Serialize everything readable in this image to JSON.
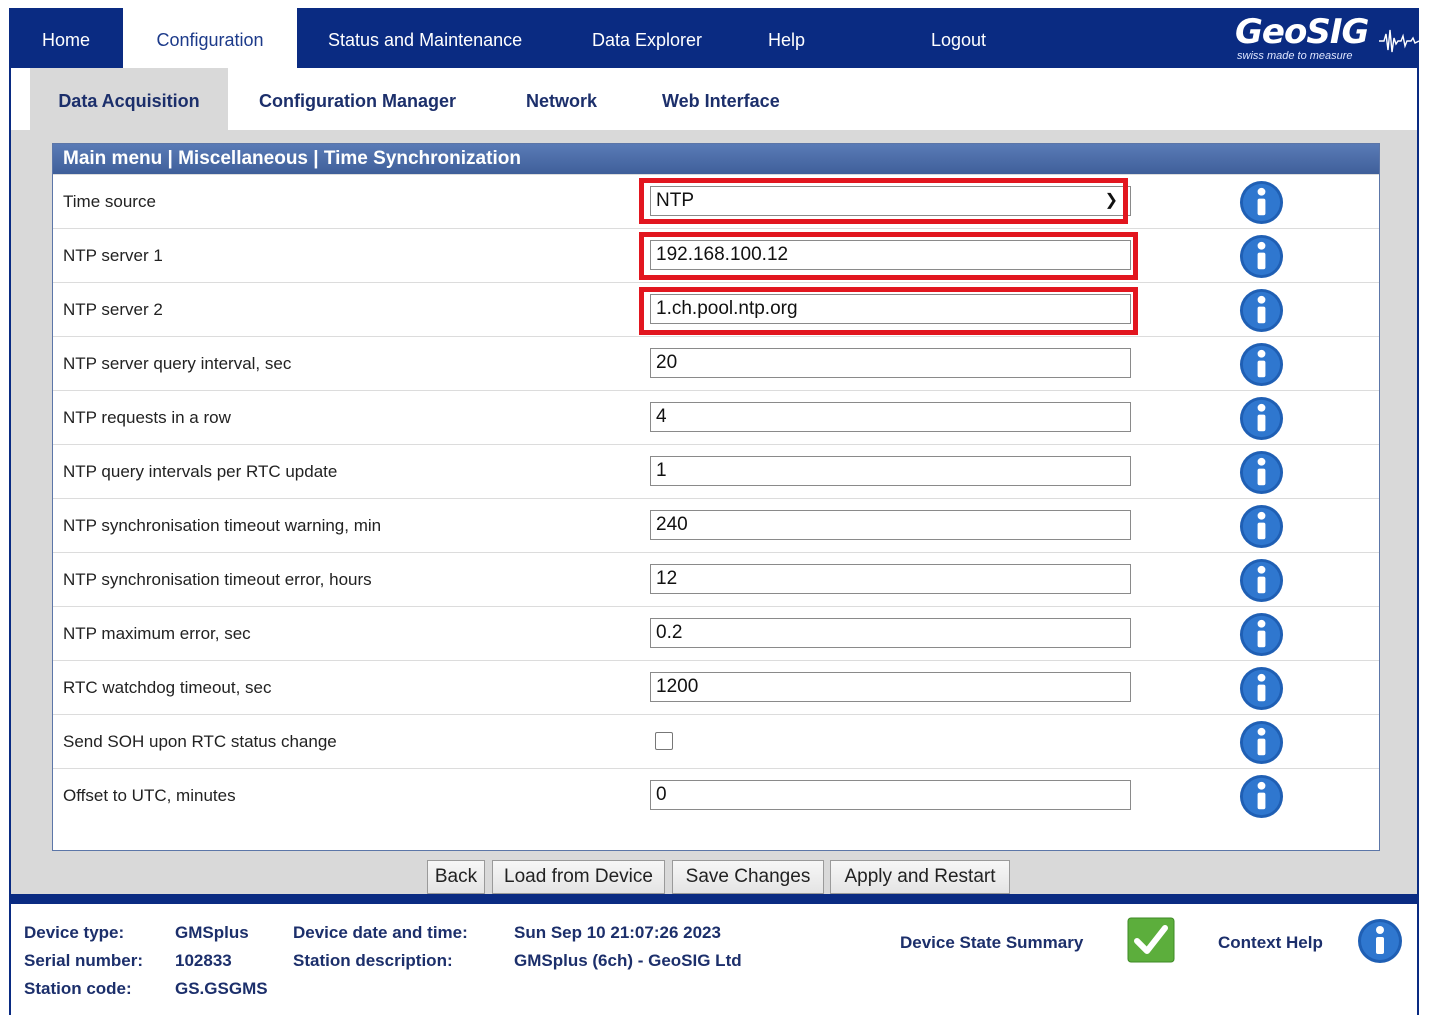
{
  "brand": {
    "name": "GeoSIG",
    "tagline": "swiss made to measure"
  },
  "top_nav": [
    "Home",
    "Configuration",
    "Status and Maintenance",
    "Data Explorer",
    "Help",
    "Logout"
  ],
  "sub_nav": [
    "Data Acquisition",
    "Configuration Manager",
    "Network",
    "Web Interface"
  ],
  "breadcrumb": "Main menu | Miscellaneous | Time Synchronization",
  "fields": [
    {
      "label": "Time source",
      "value": "NTP"
    },
    {
      "label": "NTP server 1",
      "value": "192.168.100.12"
    },
    {
      "label": "NTP server 2",
      "value": "1.ch.pool.ntp.org"
    },
    {
      "label": "NTP server query interval, sec",
      "value": "20"
    },
    {
      "label": "NTP requests in a row",
      "value": "4"
    },
    {
      "label": "NTP query intervals per RTC update",
      "value": "1"
    },
    {
      "label": "NTP synchronisation timeout warning, min",
      "value": "240"
    },
    {
      "label": "NTP synchronisation timeout error, hours",
      "value": "12"
    },
    {
      "label": "NTP maximum error, sec",
      "value": "0.2"
    },
    {
      "label": "RTC watchdog timeout, sec",
      "value": "1200"
    },
    {
      "label": "Send SOH upon RTC status change",
      "checked": false
    },
    {
      "label": "Offset to UTC, minutes",
      "value": "0"
    }
  ],
  "buttons": [
    "Back",
    "Load from Device",
    "Save Changes",
    "Apply and Restart"
  ],
  "footer": {
    "device_type_label": "Device type:",
    "device_type": "GMSplus",
    "serial_label": "Serial number:",
    "serial": "102833",
    "station_code_label": "Station code:",
    "station_code": "GS.GSGMS",
    "datetime_label": "Device date and time:",
    "datetime": "Sun Sep 10 21:07:26 2023",
    "station_desc_label": "Station description:",
    "station_desc": "GMSplus (6ch) - GeoSIG Ltd",
    "state_summary": "Device State Summary",
    "context_help": "Context Help"
  },
  "colors": {
    "nav_bg": "#0a2b82",
    "highlight": "#e2161f",
    "ok_green": "#5cae3c",
    "info_blue": "#1f5fb4"
  }
}
